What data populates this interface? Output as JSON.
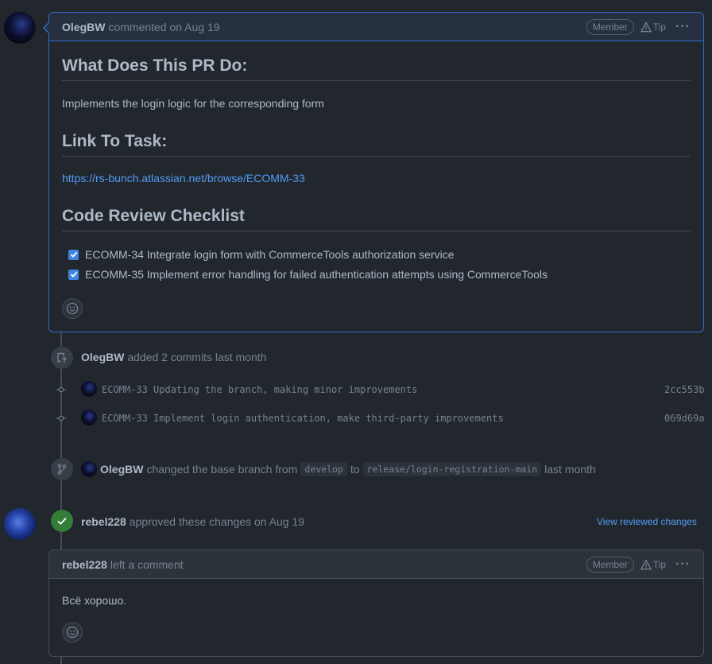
{
  "comment1": {
    "author": "OlegBW",
    "action": "commented on Aug 19",
    "badge": "Member",
    "tip": "Tip",
    "menu": "···",
    "h1": "What Does This PR Do:",
    "p1": "Implements the login logic for the corresponding form",
    "h2": "Link To Task:",
    "link": "https://rs-bunch.atlassian.net/browse/ECOMM-33",
    "h3": "Code Review Checklist",
    "checklist": [
      "ECOMM-34 Integrate login form with CommerceTools authorization service",
      "ECOMM-35 Implement error handling for failed authentication attempts using CommerceTools"
    ]
  },
  "commits_event": {
    "author": "OlegBW",
    "text": "added 2 commits last month",
    "commits": [
      {
        "message": "ECOMM-33 Updating the branch, making minor improvements",
        "sha": "2cc553b"
      },
      {
        "message": "ECOMM-33 Implement login authentication, make third-party improvements",
        "sha": "069d69a"
      }
    ]
  },
  "base_branch_event": {
    "author": "OlegBW",
    "text_before": "changed the base branch from",
    "from_branch": "develop",
    "to_word": "to",
    "to_branch": "release/login-registration-main",
    "time": "last month"
  },
  "review_event": {
    "author": "rebel228",
    "text": "approved these changes on Aug 19",
    "view_link": "View reviewed changes"
  },
  "comment2": {
    "author": "rebel228",
    "action": "left a comment",
    "badge": "Member",
    "tip": "Tip",
    "menu": "···",
    "body": "Всё хорошо."
  },
  "colors": {
    "background": "#22272e",
    "accent_blue": "#316dca",
    "link": "#539bf5",
    "success": "#347d39"
  }
}
